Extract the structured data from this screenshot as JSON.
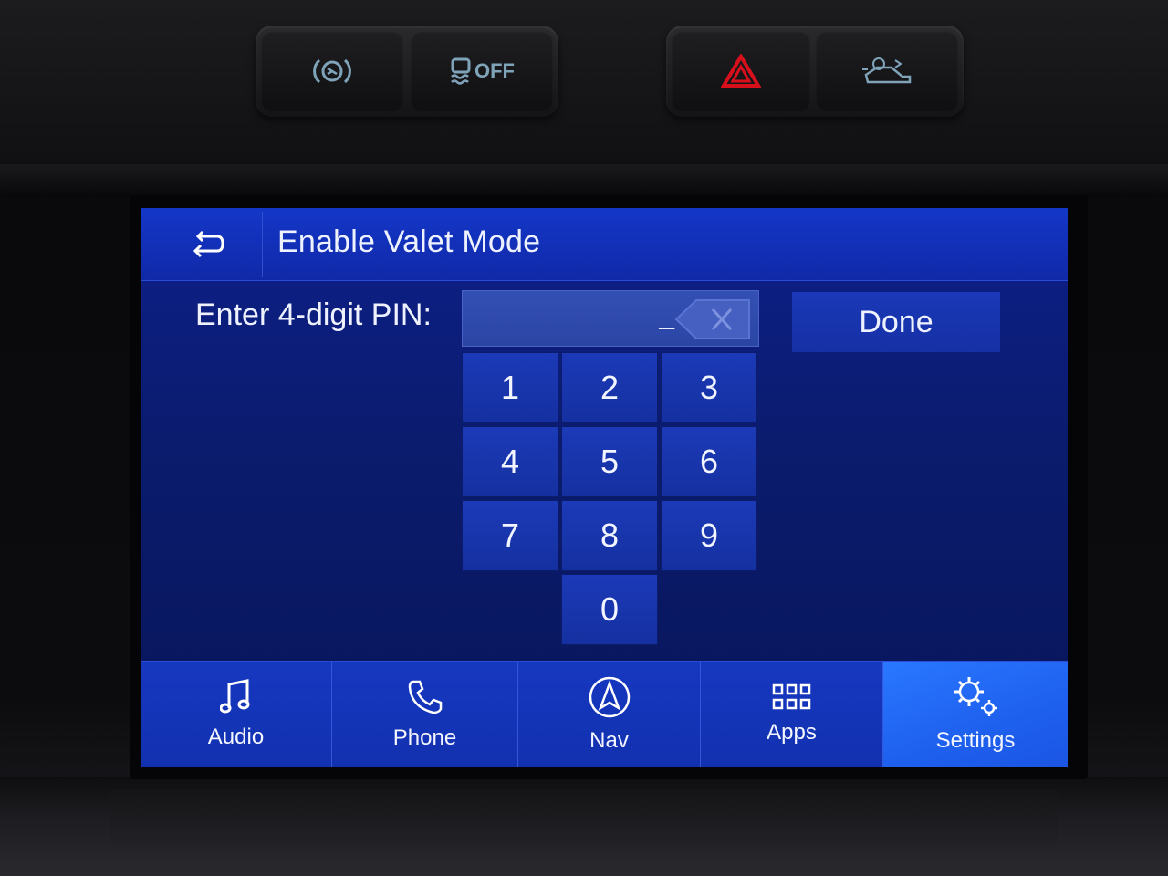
{
  "header": {
    "title": "Enable Valet Mode",
    "back_icon": "back-arrow-icon"
  },
  "pin_entry": {
    "label": "Enter 4-digit PIN:",
    "value": "_",
    "backspace_icon": "backspace-icon"
  },
  "done_label": "Done",
  "keypad": {
    "keys": [
      "1",
      "2",
      "3",
      "4",
      "5",
      "6",
      "7",
      "8",
      "9",
      "0"
    ]
  },
  "nav": {
    "items": [
      {
        "label": "Audio",
        "icon": "music-note-icon"
      },
      {
        "label": "Phone",
        "icon": "phone-icon"
      },
      {
        "label": "Nav",
        "icon": "navigation-icon"
      },
      {
        "label": "Apps",
        "icon": "apps-grid-icon"
      },
      {
        "label": "Settings",
        "icon": "settings-gear-icon"
      }
    ],
    "active": "Settings"
  },
  "hardware_buttons": {
    "traction_off_text": "OFF",
    "hazard_color": "#d8101c"
  },
  "colors": {
    "screen_bg": "#0b1c6f",
    "bar": "#1437c8",
    "active_tab": "#2a78ff"
  }
}
